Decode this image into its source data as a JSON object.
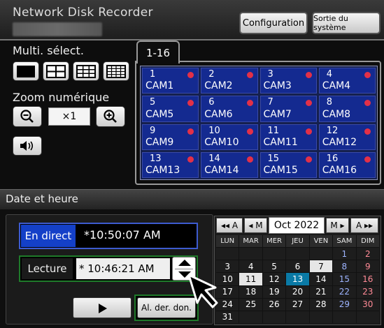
{
  "header": {
    "title": "Network Disk Recorder",
    "config_label": "Configuration",
    "exit_label": "Sortie du système"
  },
  "left_panel": {
    "multi_label": "Multi. sélect.",
    "zoom_label": "Zoom numérique",
    "zoom_value": "×1",
    "layout_icons": [
      "screen-1-icon",
      "screen-4-icon",
      "screen-9-icon",
      "screen-16-icon"
    ]
  },
  "cameras": {
    "tab_label": "1-16",
    "items": [
      {
        "num": "1",
        "name": "CAM1"
      },
      {
        "num": "2",
        "name": "CAM2"
      },
      {
        "num": "3",
        "name": "CAM3"
      },
      {
        "num": "4",
        "name": "CAM4"
      },
      {
        "num": "5",
        "name": "CAM5"
      },
      {
        "num": "6",
        "name": "CAM6"
      },
      {
        "num": "7",
        "name": "CAM7"
      },
      {
        "num": "8",
        "name": "CAM8"
      },
      {
        "num": "9",
        "name": "CAM9"
      },
      {
        "num": "10",
        "name": "CAM10"
      },
      {
        "num": "11",
        "name": "CAM11"
      },
      {
        "num": "12",
        "name": "CAM12"
      },
      {
        "num": "13",
        "name": "CAM13"
      },
      {
        "num": "14",
        "name": "CAM14"
      },
      {
        "num": "15",
        "name": "CAM15"
      },
      {
        "num": "16",
        "name": "CAM16"
      }
    ],
    "rec_dot_color": "#e23048",
    "tile_color": "#142a90"
  },
  "datetime": {
    "section_title": "Date et heure",
    "live_label": "En direct",
    "live_time": "*10:50:07 AM",
    "playback_label": "Lecture",
    "playback_time": "* 10:46:21 AM",
    "last_label": "Al. der. don."
  },
  "calendar": {
    "prev_year": "◂◂ A",
    "prev_month": "◂ M",
    "month": "Oct 2022",
    "next_month": "M ▸",
    "next_year": "A ▸▸",
    "weekdays": [
      "LUN",
      "MAR",
      "MER",
      "JEU",
      "VEN",
      "SAM",
      "DIM"
    ],
    "weeks": [
      [
        "",
        "",
        "",
        "",
        "",
        "1",
        "2"
      ],
      [
        "3",
        "4",
        "5",
        "6",
        "7",
        "8",
        "9"
      ],
      [
        "10",
        "11",
        "12",
        "13",
        "14",
        "15",
        "16"
      ],
      [
        "17",
        "18",
        "19",
        "20",
        "21",
        "22",
        "23"
      ],
      [
        "24",
        "25",
        "26",
        "27",
        "28",
        "29",
        "30"
      ],
      [
        "31",
        "",
        "",
        "",
        "",
        "",
        ""
      ]
    ],
    "highlighted_light": [
      "7",
      "11"
    ],
    "selected": "13"
  }
}
